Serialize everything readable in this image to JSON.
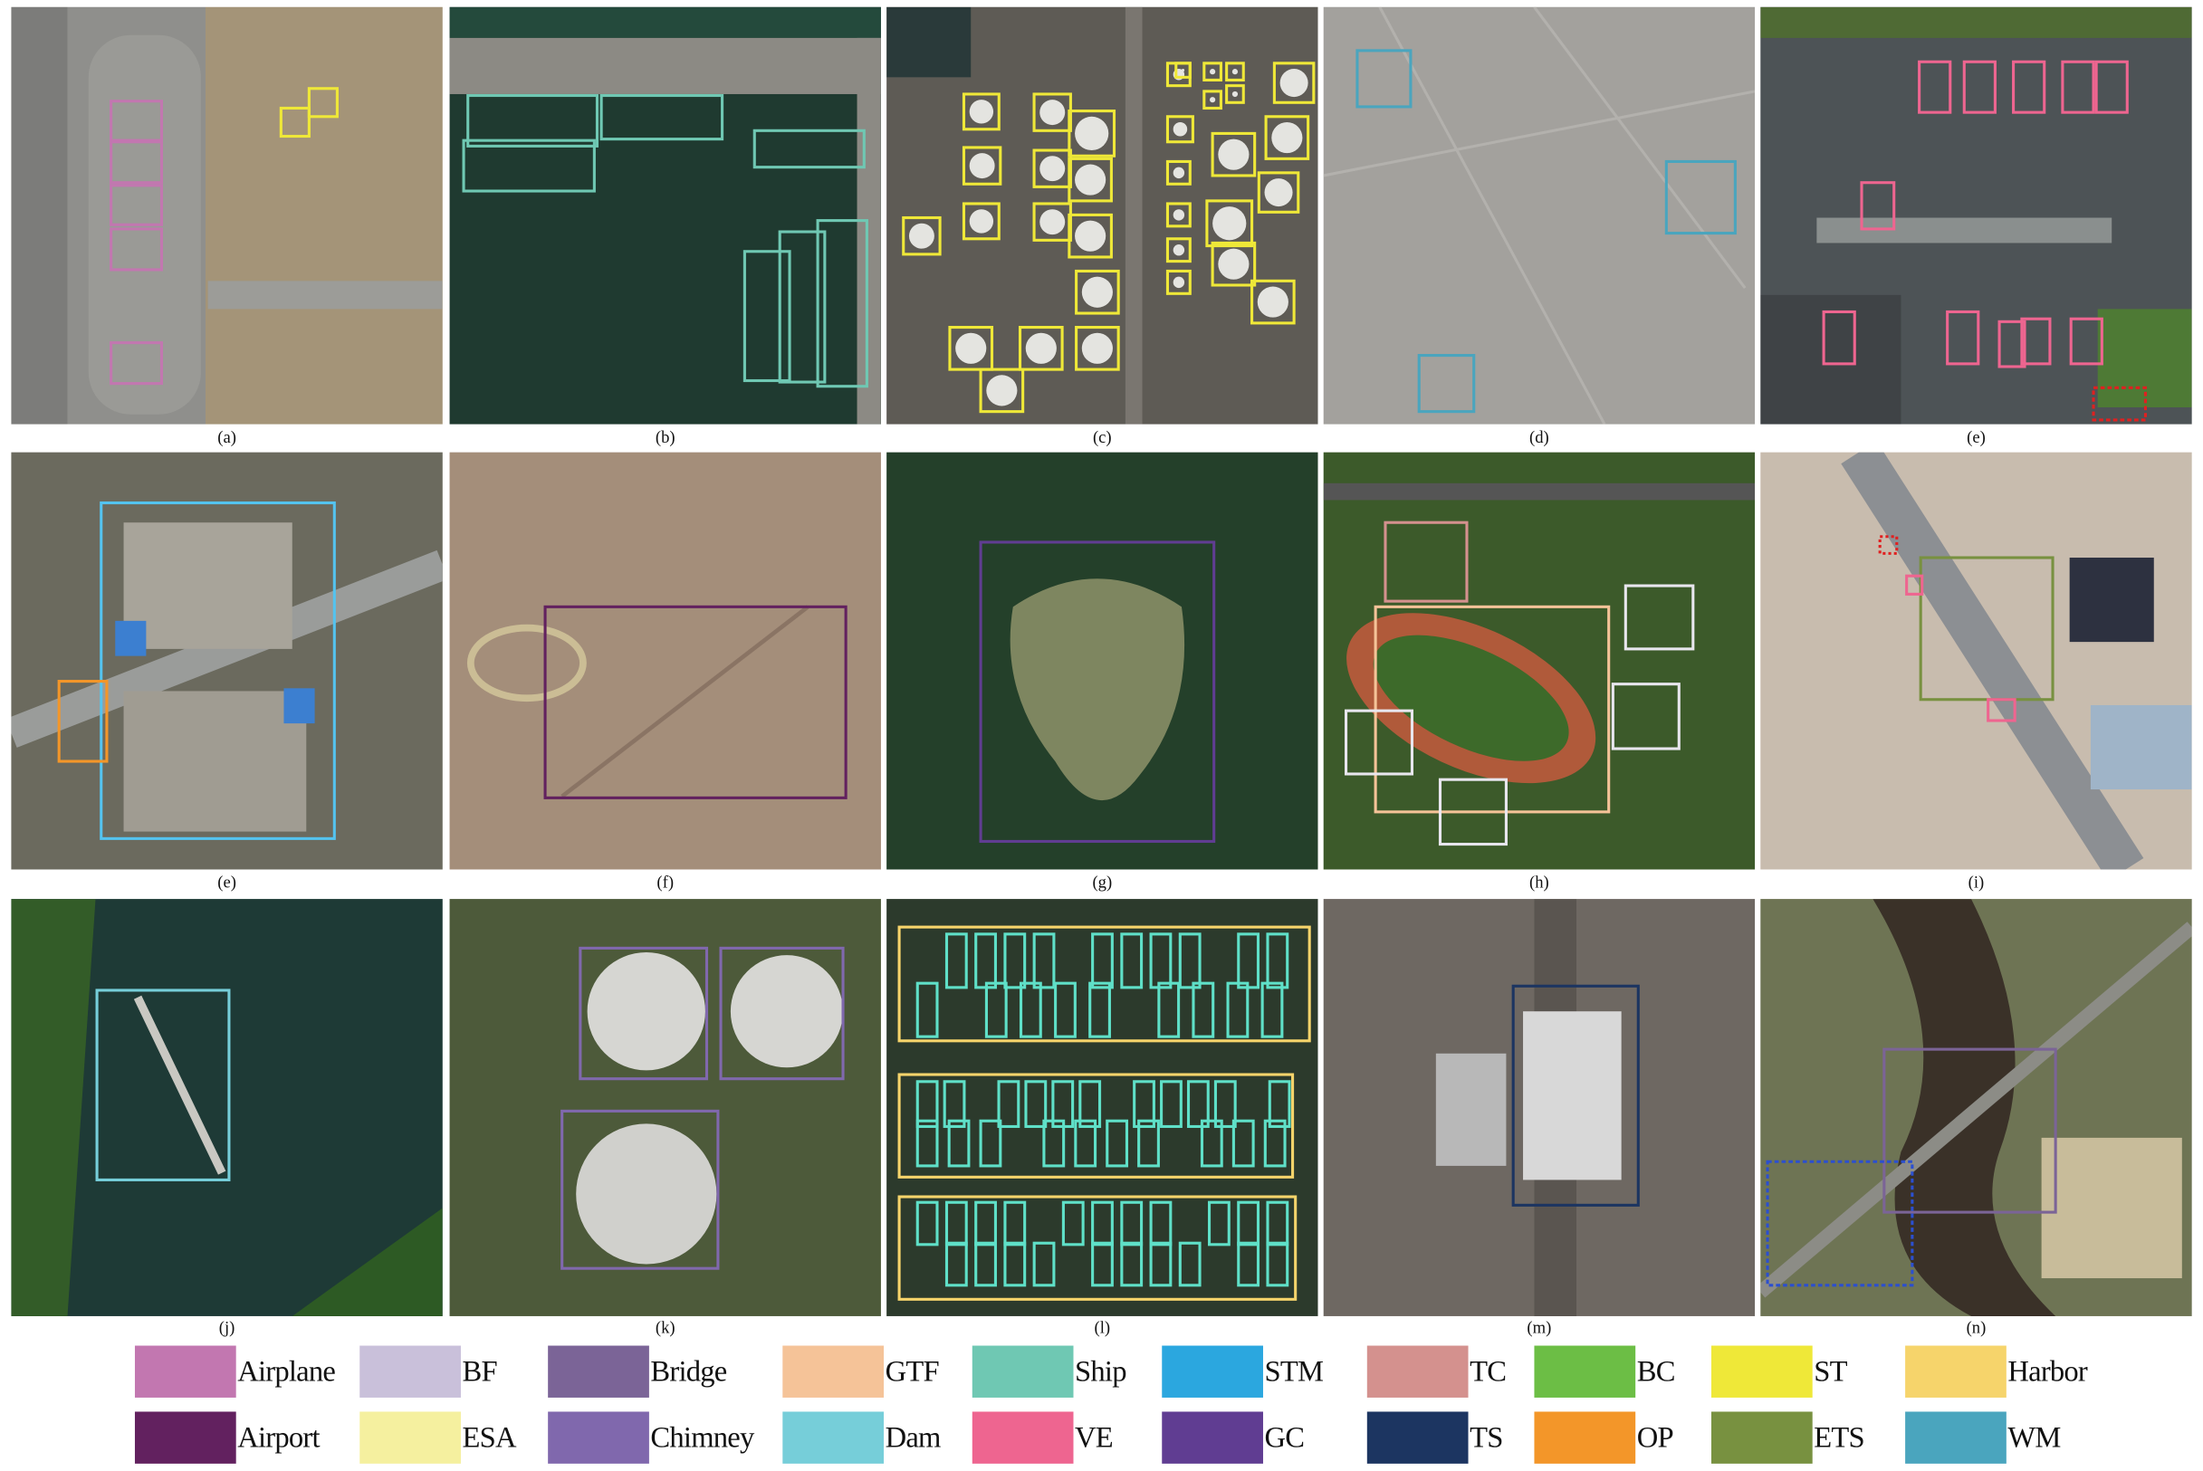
{
  "panels": [
    {
      "label": "(a)"
    },
    {
      "label": "(b)"
    },
    {
      "label": "(c)"
    },
    {
      "label": "(d)"
    },
    {
      "label": "(e)"
    },
    {
      "label": "(e)"
    },
    {
      "label": "(f)"
    },
    {
      "label": "(g)"
    },
    {
      "label": "(h)"
    },
    {
      "label": "(i)"
    },
    {
      "label": "(j)"
    },
    {
      "label": "(k)"
    },
    {
      "label": "(l)"
    },
    {
      "label": "(m)"
    },
    {
      "label": "(n)"
    }
  ],
  "legend": [
    {
      "label": "Airplane",
      "color": "#c277b0"
    },
    {
      "label": "BF",
      "color": "#c9c0da"
    },
    {
      "label": "Bridge",
      "color": "#7b6497"
    },
    {
      "label": "GTF",
      "color": "#f5c398"
    },
    {
      "label": "Ship",
      "color": "#6fc8b3"
    },
    {
      "label": "STM",
      "color": "#2ba7df"
    },
    {
      "label": "TC",
      "color": "#d4918e"
    },
    {
      "label": "BC",
      "color": "#6cbe45"
    },
    {
      "label": "ST",
      "color": "#efe838"
    },
    {
      "label": "Harbor",
      "color": "#f6d46b"
    },
    {
      "label": "Airport",
      "color": "#62215f"
    },
    {
      "label": "ESA",
      "color": "#f5f09f"
    },
    {
      "label": "Chimney",
      "color": "#8068ad"
    },
    {
      "label": "Dam",
      "color": "#76ced9"
    },
    {
      "label": "VE",
      "color": "#ee6590"
    },
    {
      "label": "GC",
      "color": "#603d92"
    },
    {
      "label": "TS",
      "color": "#1c3561"
    },
    {
      "label": "OP",
      "color": "#f39629"
    },
    {
      "label": "ETS",
      "color": "#789140"
    },
    {
      "label": "WM",
      "color": "#4aa5be"
    }
  ]
}
